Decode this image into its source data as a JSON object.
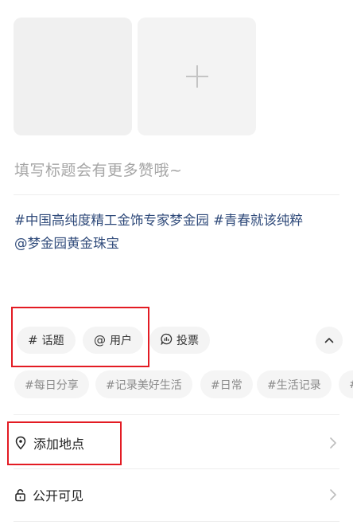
{
  "media": {
    "add_icon": "plus-icon"
  },
  "title": {
    "placeholder": "填写标题会有更多赞哦~"
  },
  "content": {
    "line1": "#中国高纯度精工金饰专家梦金园 #青春就该纯粹",
    "line2": "@梦金园黄金珠宝"
  },
  "toolbar": {
    "topic_label": "话题",
    "topic_icon": "#",
    "user_label": "用户",
    "user_icon": "@",
    "vote_label": "投票",
    "collapse_icon": "chevron-up-icon"
  },
  "tags": [
    "#每日分享",
    "#记录美好生活",
    "#日常",
    "#生活记录",
    "#"
  ],
  "location": {
    "label": "添加地点",
    "icon": "location-pin-icon"
  },
  "visibility": {
    "label": "公开可见",
    "icon": "lock-icon"
  },
  "colors": {
    "highlight": "#e31b23",
    "mention": "#2f4a7a",
    "chip_bg": "#f4f4f4"
  }
}
